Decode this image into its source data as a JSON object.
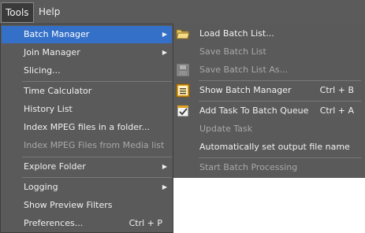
{
  "menubar": {
    "tools": "Tools",
    "help": "Help"
  },
  "tools_menu": {
    "items": [
      {
        "label": "Batch Manager",
        "submenu": true
      },
      {
        "label": "Join Manager",
        "submenu": true
      },
      {
        "label": "Slicing..."
      },
      {
        "label": "Time Calculator"
      },
      {
        "label": "History List"
      },
      {
        "label": "Index MPEG files in a folder..."
      },
      {
        "label": "Index MPEG Files from Media list",
        "disabled": true
      },
      {
        "label": "Explore Folder",
        "submenu": true
      },
      {
        "label": "Logging",
        "submenu": true
      },
      {
        "label": "Show Preview Filters"
      },
      {
        "label": "Preferences...",
        "shortcut": "Ctrl + P"
      }
    ]
  },
  "batch_submenu": {
    "items": [
      {
        "label": "Load Batch List...",
        "icon": "folder-open-icon"
      },
      {
        "label": "Save Batch List",
        "disabled": true
      },
      {
        "label": "Save Batch List As...",
        "disabled": true,
        "icon": "save-icon"
      },
      {
        "label": "Show Batch Manager",
        "shortcut": "Ctrl + B",
        "icon": "batch-list-icon"
      },
      {
        "label": "Add Task To Batch Queue",
        "shortcut": "Ctrl + A",
        "icon": "add-task-icon"
      },
      {
        "label": "Update Task",
        "disabled": true
      },
      {
        "label": "Automatically set output file name"
      },
      {
        "label": "Start Batch Processing",
        "disabled": true
      }
    ]
  },
  "colors": {
    "menu_bg": "#5a5a5a",
    "highlight": "#3470c8",
    "disabled_text": "#a8a8a8"
  }
}
